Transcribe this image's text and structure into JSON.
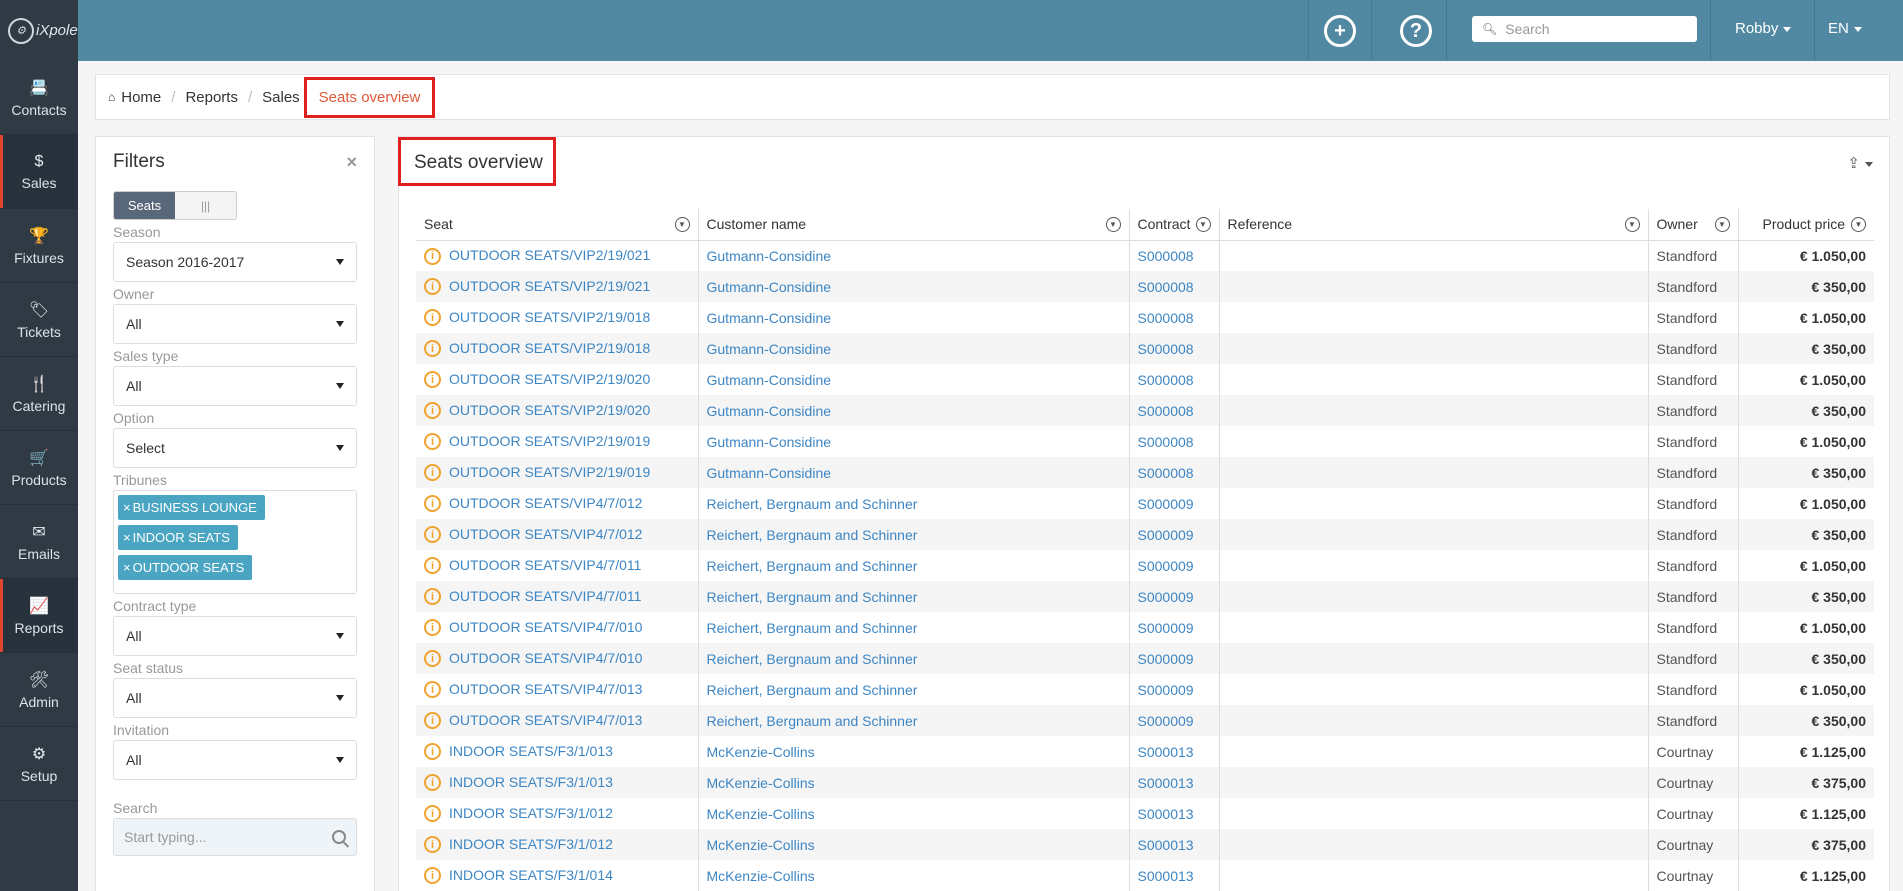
{
  "app": {
    "logo_text": "iXpole",
    "logo_mark": "⚙"
  },
  "sidebar": {
    "items": [
      {
        "label": "Contacts",
        "icon": "📇"
      },
      {
        "label": "Sales",
        "icon": "$"
      },
      {
        "label": "Fixtures",
        "icon": "🏆"
      },
      {
        "label": "Tickets",
        "icon": "🏷"
      },
      {
        "label": "Catering",
        "icon": "🍴"
      },
      {
        "label": "Products",
        "icon": "🛒"
      },
      {
        "label": "Emails",
        "icon": "✉"
      },
      {
        "label": "Reports",
        "icon": "📈"
      },
      {
        "label": "Admin",
        "icon": "🛠"
      },
      {
        "label": "Setup",
        "icon": "⚙"
      }
    ]
  },
  "topbar": {
    "add_icon": "+",
    "help_icon": "?",
    "search_placeholder": "Search",
    "user": "Robby",
    "language": "EN"
  },
  "breadcrumb": {
    "home": "Home",
    "reports": "Reports",
    "sales": "Sales",
    "current": "Seats overview",
    "separator": "/"
  },
  "filters": {
    "title": "Filters",
    "close": "×",
    "toggle_on": "Seats",
    "toggle_off": "|||",
    "season": {
      "label": "Season",
      "value": "Season 2016-2017"
    },
    "owner": {
      "label": "Owner",
      "value": "All"
    },
    "sales_type": {
      "label": "Sales type",
      "value": "All"
    },
    "option": {
      "label": "Option",
      "value": "Select"
    },
    "tribunes": {
      "label": "Tribunes",
      "tags": [
        "BUSINESS LOUNGE",
        "INDOOR SEATS",
        "OUTDOOR SEATS"
      ],
      "remove": "×"
    },
    "contract_type": {
      "label": "Contract type",
      "value": "All"
    },
    "seat_status": {
      "label": "Seat status",
      "value": "All"
    },
    "invitation": {
      "label": "Invitation",
      "value": "All"
    },
    "search": {
      "label": "Search",
      "placeholder": "Start typing..."
    }
  },
  "main": {
    "title": "Seats overview",
    "export_icon": "⇪",
    "columns": [
      "Seat",
      "Customer name",
      "Contract",
      "Reference",
      "Owner",
      "Product price"
    ],
    "filter_icon": "▼",
    "info_icon": "i",
    "rows": [
      {
        "seat": "OUTDOOR SEATS/VIP2/19/021",
        "customer": "Gutmann-Considine",
        "contract": "S000008",
        "reference": "",
        "owner": "Standford",
        "price": "€ 1.050,00"
      },
      {
        "seat": "OUTDOOR SEATS/VIP2/19/021",
        "customer": "Gutmann-Considine",
        "contract": "S000008",
        "reference": "",
        "owner": "Standford",
        "price": "€ 350,00"
      },
      {
        "seat": "OUTDOOR SEATS/VIP2/19/018",
        "customer": "Gutmann-Considine",
        "contract": "S000008",
        "reference": "",
        "owner": "Standford",
        "price": "€ 1.050,00"
      },
      {
        "seat": "OUTDOOR SEATS/VIP2/19/018",
        "customer": "Gutmann-Considine",
        "contract": "S000008",
        "reference": "",
        "owner": "Standford",
        "price": "€ 350,00"
      },
      {
        "seat": "OUTDOOR SEATS/VIP2/19/020",
        "customer": "Gutmann-Considine",
        "contract": "S000008",
        "reference": "",
        "owner": "Standford",
        "price": "€ 1.050,00"
      },
      {
        "seat": "OUTDOOR SEATS/VIP2/19/020",
        "customer": "Gutmann-Considine",
        "contract": "S000008",
        "reference": "",
        "owner": "Standford",
        "price": "€ 350,00"
      },
      {
        "seat": "OUTDOOR SEATS/VIP2/19/019",
        "customer": "Gutmann-Considine",
        "contract": "S000008",
        "reference": "",
        "owner": "Standford",
        "price": "€ 1.050,00"
      },
      {
        "seat": "OUTDOOR SEATS/VIP2/19/019",
        "customer": "Gutmann-Considine",
        "contract": "S000008",
        "reference": "",
        "owner": "Standford",
        "price": "€ 350,00"
      },
      {
        "seat": "OUTDOOR SEATS/VIP4/7/012",
        "customer": "Reichert, Bergnaum and Schinner",
        "contract": "S000009",
        "reference": "",
        "owner": "Standford",
        "price": "€ 1.050,00"
      },
      {
        "seat": "OUTDOOR SEATS/VIP4/7/012",
        "customer": "Reichert, Bergnaum and Schinner",
        "contract": "S000009",
        "reference": "",
        "owner": "Standford",
        "price": "€ 350,00"
      },
      {
        "seat": "OUTDOOR SEATS/VIP4/7/011",
        "customer": "Reichert, Bergnaum and Schinner",
        "contract": "S000009",
        "reference": "",
        "owner": "Standford",
        "price": "€ 1.050,00"
      },
      {
        "seat": "OUTDOOR SEATS/VIP4/7/011",
        "customer": "Reichert, Bergnaum and Schinner",
        "contract": "S000009",
        "reference": "",
        "owner": "Standford",
        "price": "€ 350,00"
      },
      {
        "seat": "OUTDOOR SEATS/VIP4/7/010",
        "customer": "Reichert, Bergnaum and Schinner",
        "contract": "S000009",
        "reference": "",
        "owner": "Standford",
        "price": "€ 1.050,00"
      },
      {
        "seat": "OUTDOOR SEATS/VIP4/7/010",
        "customer": "Reichert, Bergnaum and Schinner",
        "contract": "S000009",
        "reference": "",
        "owner": "Standford",
        "price": "€ 350,00"
      },
      {
        "seat": "OUTDOOR SEATS/VIP4/7/013",
        "customer": "Reichert, Bergnaum and Schinner",
        "contract": "S000009",
        "reference": "",
        "owner": "Standford",
        "price": "€ 1.050,00"
      },
      {
        "seat": "OUTDOOR SEATS/VIP4/7/013",
        "customer": "Reichert, Bergnaum and Schinner",
        "contract": "S000009",
        "reference": "",
        "owner": "Standford",
        "price": "€ 350,00"
      },
      {
        "seat": "INDOOR SEATS/F3/1/013",
        "customer": "McKenzie-Collins",
        "contract": "S000013",
        "reference": "",
        "owner": "Courtnay",
        "price": "€ 1.125,00"
      },
      {
        "seat": "INDOOR SEATS/F3/1/013",
        "customer": "McKenzie-Collins",
        "contract": "S000013",
        "reference": "",
        "owner": "Courtnay",
        "price": "€ 375,00"
      },
      {
        "seat": "INDOOR SEATS/F3/1/012",
        "customer": "McKenzie-Collins",
        "contract": "S000013",
        "reference": "",
        "owner": "Courtnay",
        "price": "€ 1.125,00"
      },
      {
        "seat": "INDOOR SEATS/F3/1/012",
        "customer": "McKenzie-Collins",
        "contract": "S000013",
        "reference": "",
        "owner": "Courtnay",
        "price": "€ 375,00"
      },
      {
        "seat": "INDOOR SEATS/F3/1/014",
        "customer": "McKenzie-Collins",
        "contract": "S000013",
        "reference": "",
        "owner": "Courtnay",
        "price": "€ 1.125,00"
      }
    ]
  }
}
